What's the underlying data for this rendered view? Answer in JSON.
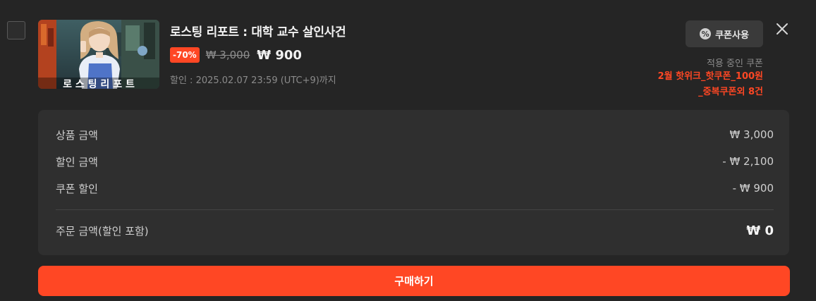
{
  "item": {
    "title": "로스팅 리포트 : 대학 교수 살인사건",
    "discount_badge": "-70%",
    "original_price": "₩ 3,000",
    "sale_price": "₩ 900",
    "deadline": "할인 : 2025.02.07 23:59 (UTC+9)까지",
    "thumbnail_text": "로 스 팅  리 포 트"
  },
  "coupon": {
    "button_label": "쿠폰사용",
    "applied_label": "적용 중인 쿠폰",
    "applied_line1": "2월 핫위크_핫쿠폰_100원",
    "applied_line2": "_중복쿠폰외 8건"
  },
  "summary": {
    "rows": [
      {
        "label": "상품 금액",
        "value": "₩ 3,000"
      },
      {
        "label": "할인 금액",
        "value": "- ₩ 2,100"
      },
      {
        "label": "쿠폰 할인",
        "value": "- ₩ 900"
      }
    ],
    "total_label": "주문 금액(할인 포함)",
    "total_value": "₩ 0"
  },
  "purchase_button_label": "구매하기",
  "colors": {
    "accent": "#ff4724",
    "background": "#252525",
    "panel": "#2f2f2f"
  },
  "icons": {
    "coupon": "coupon-percent-icon",
    "close": "close-icon"
  }
}
